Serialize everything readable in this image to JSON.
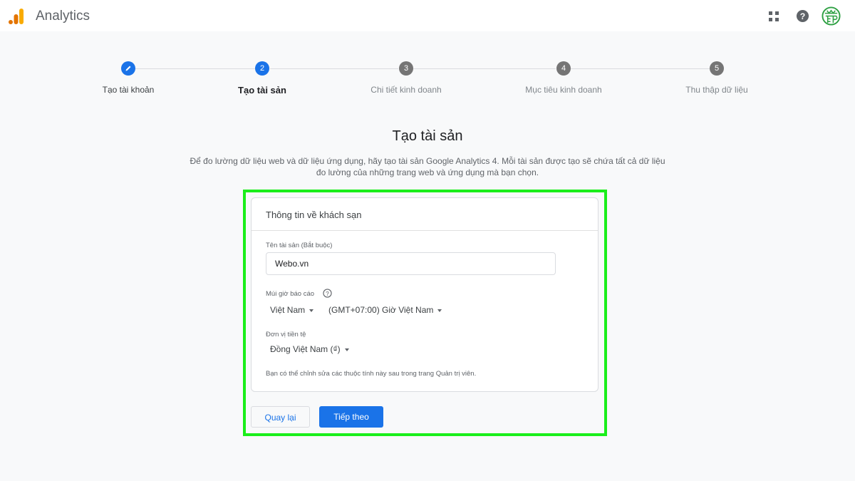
{
  "header": {
    "app_title": "Analytics",
    "icons": [
      "analytics-logo",
      "apps-grid-icon",
      "help-icon",
      "avatar"
    ]
  },
  "stepper": {
    "steps": [
      {
        "label": "Tạo tài khoản",
        "marker": "pencil",
        "state": "done"
      },
      {
        "label": "Tạo tài sản",
        "marker": "2",
        "state": "current"
      },
      {
        "label": "Chi tiết kinh doanh",
        "marker": "3",
        "state": "todo"
      },
      {
        "label": "Mục tiêu kinh doanh",
        "marker": "4",
        "state": "todo"
      },
      {
        "label": "Thu thập dữ liệu",
        "marker": "5",
        "state": "todo"
      }
    ]
  },
  "page": {
    "title": "Tạo tài sản",
    "description": "Để đo lường dữ liệu web và dữ liệu ứng dụng, hãy tạo tài sản Google Analytics 4. Mỗi tài sản được tạo sẽ chứa tất cả dữ liệu đo lường của những trang web và ứng dụng mà bạn chọn."
  },
  "card": {
    "title": "Thông tin về khách sạn",
    "property_name_label": "Tên tài sản (Bắt buộc)",
    "property_name_value": "Webo.vn",
    "timezone_label": "Múi giờ báo cáo",
    "country": "Việt Nam",
    "timezone": "(GMT+07:00) Giờ Việt Nam",
    "currency_label": "Đơn vị tiền tệ",
    "currency": "Đồng Việt Nam (₫)",
    "note": "Bạn có thể chỉnh sửa các thuộc tính này sau trong trang Quản trị viên."
  },
  "buttons": {
    "back": "Quay lại",
    "next": "Tiếp theo"
  },
  "colors": {
    "accent": "#1a73e8",
    "highlight": "#1aee1a"
  }
}
